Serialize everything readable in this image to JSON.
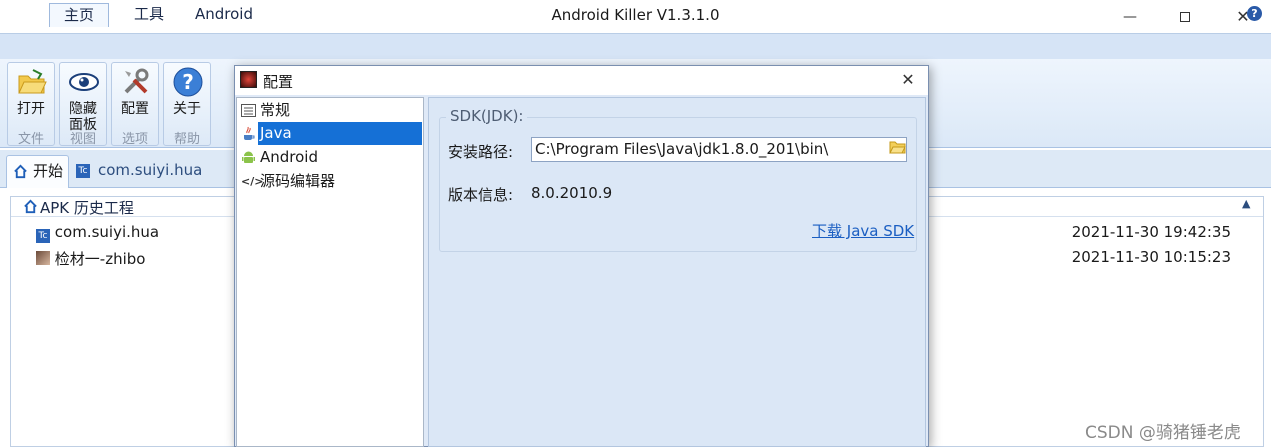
{
  "window": {
    "title": "Android Killer V1.3.1.0"
  },
  "ribbon": {
    "tabs": [
      "主页",
      "工具",
      "Android"
    ],
    "buttons": [
      {
        "label": "打开",
        "icon": "folder-open-icon"
      },
      {
        "label": "隐藏面板",
        "icon": "eye-icon"
      },
      {
        "label": "配置",
        "icon": "tools-icon"
      },
      {
        "label": "关于",
        "icon": "question-icon"
      }
    ],
    "groups": [
      "文件",
      "视图",
      "选项",
      "帮助"
    ]
  },
  "doc_tabs": {
    "start": "开始",
    "package": "com.suiyi.hua"
  },
  "history": {
    "title": "APK 历史工程",
    "rows": [
      {
        "name": "com.suiyi.hua",
        "time": "2021-11-30 19:42:35"
      },
      {
        "name": "检材一-zhibo",
        "time": "2021-11-30 10:15:23"
      }
    ]
  },
  "dialog": {
    "title": "配置",
    "tree": [
      {
        "label": "常规",
        "icon": "list-icon"
      },
      {
        "label": "Java",
        "icon": "java-icon",
        "selected": true
      },
      {
        "label": "Android",
        "icon": "android-icon"
      },
      {
        "label": "源码编辑器",
        "icon": "code-icon"
      }
    ],
    "sdk": {
      "legend": "SDK(JDK):",
      "path_label": "安装路径:",
      "path_value": "C:\\Program Files\\Java\\jdk1.8.0_201\\bin\\",
      "version_label": "版本信息:",
      "version_value": "8.0.2010.9",
      "download_link": "下载 Java SDK"
    }
  },
  "watermark": "CSDN @骑猪锤老虎",
  "colors": {
    "ribbon_bg": "#d6e4f6",
    "selection": "#1570d6",
    "link": "#1a5ec2"
  }
}
